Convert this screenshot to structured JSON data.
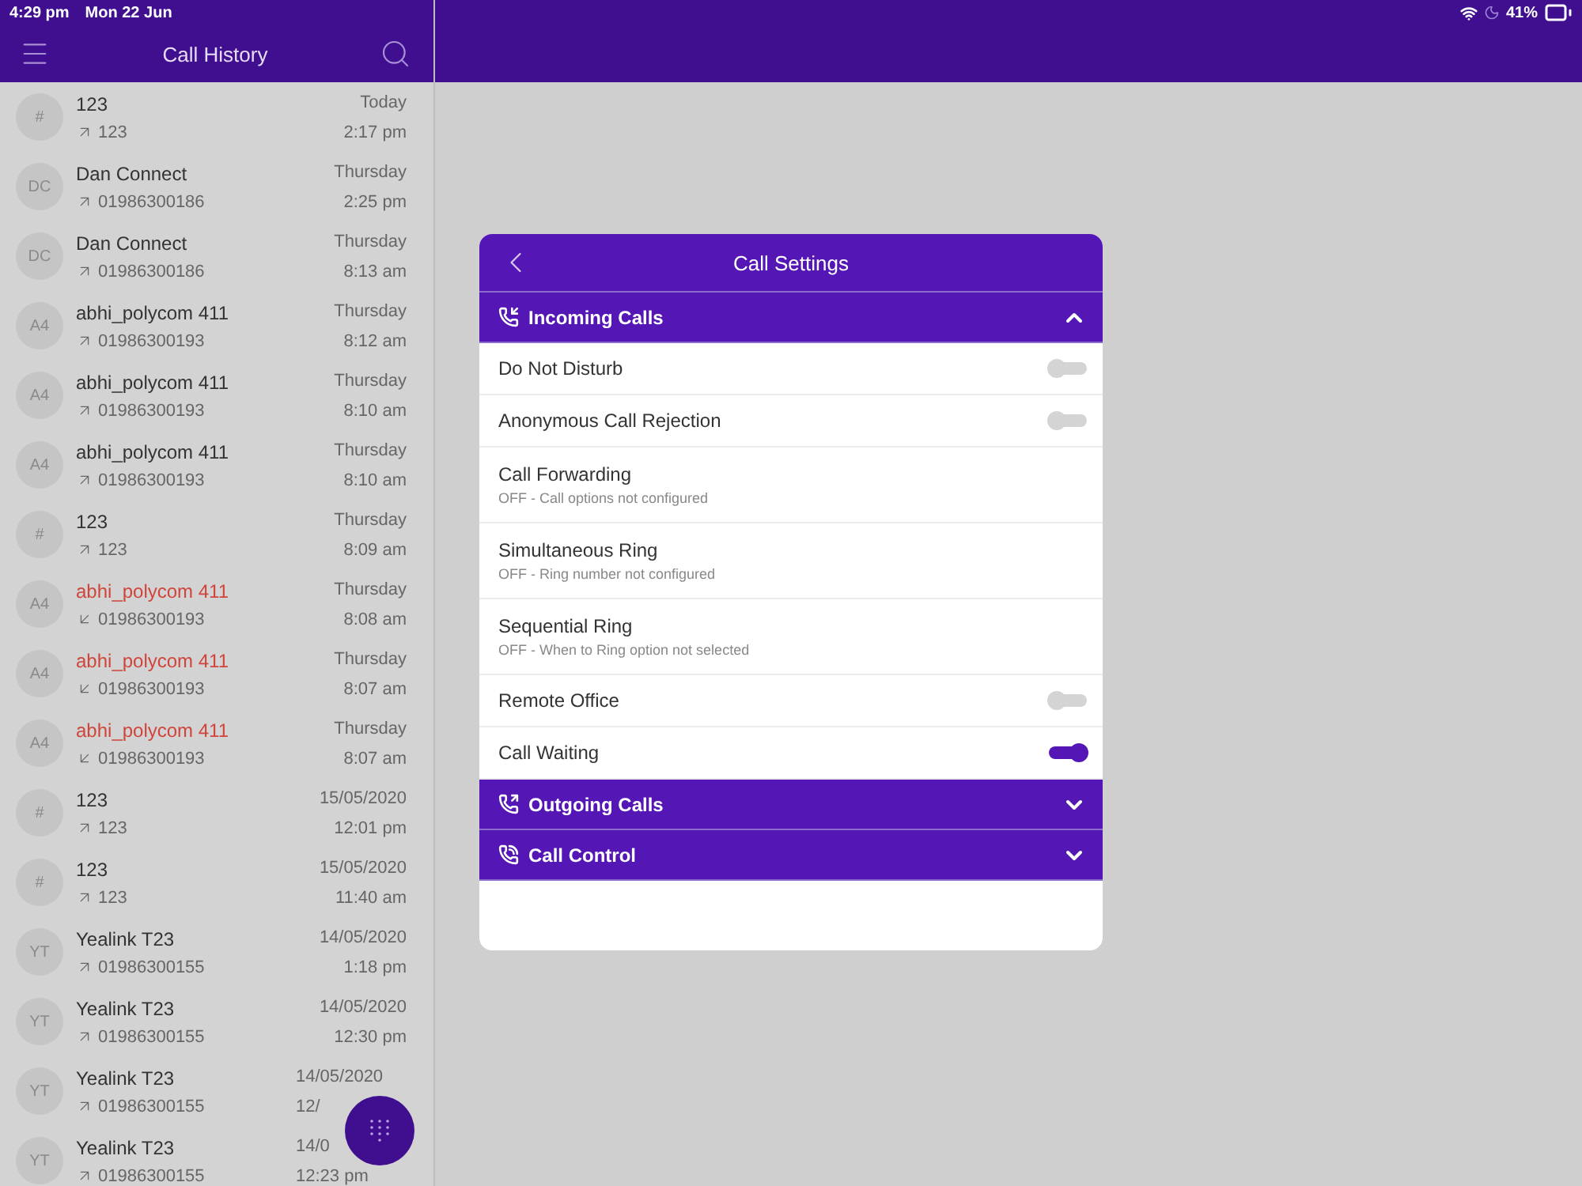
{
  "status_bar": {
    "time": "4:29 pm",
    "date": "Mon 22 Jun",
    "battery": "41%"
  },
  "sidebar": {
    "title": "Call History",
    "calls": [
      {
        "avatar": "#",
        "name": "123",
        "number": "123",
        "date": "Today",
        "time": "2:17 pm",
        "kind": "outgoing"
      },
      {
        "avatar": "DC",
        "name": "Dan Connect",
        "number": "01986300186",
        "date": "Thursday",
        "time": "2:25 pm",
        "kind": "outgoing"
      },
      {
        "avatar": "DC",
        "name": "Dan Connect",
        "number": "01986300186",
        "date": "Thursday",
        "time": "8:13 am",
        "kind": "outgoing"
      },
      {
        "avatar": "A4",
        "name": "abhi_polycom 411",
        "number": "01986300193",
        "date": "Thursday",
        "time": "8:12 am",
        "kind": "outgoing"
      },
      {
        "avatar": "A4",
        "name": "abhi_polycom 411",
        "number": "01986300193",
        "date": "Thursday",
        "time": "8:10 am",
        "kind": "outgoing"
      },
      {
        "avatar": "A4",
        "name": "abhi_polycom 411",
        "number": "01986300193",
        "date": "Thursday",
        "time": "8:10 am",
        "kind": "outgoing"
      },
      {
        "avatar": "#",
        "name": "123",
        "number": "123",
        "date": "Thursday",
        "time": "8:09 am",
        "kind": "outgoing"
      },
      {
        "avatar": "A4",
        "name": "abhi_polycom 411",
        "number": "01986300193",
        "date": "Thursday",
        "time": "8:08 am",
        "kind": "missed"
      },
      {
        "avatar": "A4",
        "name": "abhi_polycom 411",
        "number": "01986300193",
        "date": "Thursday",
        "time": "8:07 am",
        "kind": "missed"
      },
      {
        "avatar": "A4",
        "name": "abhi_polycom 411",
        "number": "01986300193",
        "date": "Thursday",
        "time": "8:07 am",
        "kind": "missed"
      },
      {
        "avatar": "#",
        "name": "123",
        "number": "123",
        "date": "15/05/2020",
        "time": "12:01 pm",
        "kind": "outgoing"
      },
      {
        "avatar": "#",
        "name": "123",
        "number": "123",
        "date": "15/05/2020",
        "time": "11:40 am",
        "kind": "outgoing"
      },
      {
        "avatar": "YT",
        "name": "Yealink T23",
        "number": "01986300155",
        "date": "14/05/2020",
        "time": "1:18 pm",
        "kind": "outgoing"
      },
      {
        "avatar": "YT",
        "name": "Yealink T23",
        "number": "01986300155",
        "date": "14/05/2020",
        "time": "12:30 pm",
        "kind": "outgoing"
      },
      {
        "avatar": "YT",
        "name": "Yealink T23",
        "number": "01986300155",
        "date": "14/05/2020",
        "time": "12/",
        "kind": "outgoing",
        "obscured": true
      },
      {
        "avatar": "YT",
        "name": "Yealink T23",
        "number": "01986300155",
        "date": "14/0",
        "time": "12:23 pm",
        "kind": "outgoing",
        "obscured": true
      }
    ]
  },
  "dialog": {
    "title": "Call Settings",
    "sections": [
      {
        "title": "Incoming Calls",
        "expanded": true,
        "items": [
          {
            "kind": "toggle",
            "label": "Do Not Disturb",
            "on": false
          },
          {
            "kind": "toggle",
            "label": "Anonymous Call Rejection",
            "on": false
          },
          {
            "kind": "detail",
            "label": "Call Forwarding",
            "subtitle": "OFF - Call options not configured"
          },
          {
            "kind": "detail",
            "label": "Simultaneous Ring",
            "subtitle": "OFF - Ring number not configured"
          },
          {
            "kind": "detail",
            "label": "Sequential Ring",
            "subtitle": "OFF - When to Ring option not selected"
          },
          {
            "kind": "toggle",
            "label": "Remote Office",
            "on": false
          },
          {
            "kind": "toggle",
            "label": "Call Waiting",
            "on": true
          }
        ]
      },
      {
        "title": "Outgoing Calls",
        "expanded": false
      },
      {
        "title": "Call Control",
        "expanded": false
      }
    ]
  }
}
